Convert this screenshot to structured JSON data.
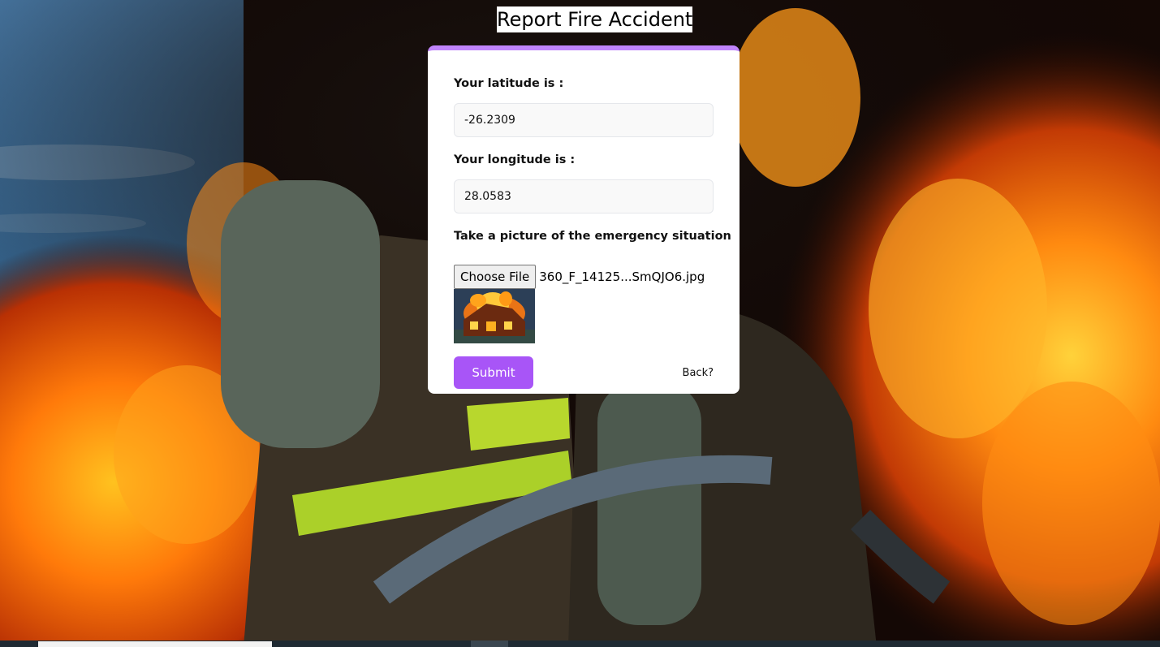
{
  "page": {
    "title": "Report Fire Accident"
  },
  "form": {
    "latitude_label": "Your latitude is :",
    "latitude_value": "-26.2309",
    "longitude_label": "Your longitude is :",
    "longitude_value": "28.0583",
    "picture_label": "Take a picture of the emergency situation",
    "choose_file_label": "Choose File",
    "file_name": "360_F_14125...SmQJO6.jpg",
    "submit_label": "Submit",
    "back_label": "Back?"
  },
  "colors": {
    "accent": "#a855f7",
    "card_top_border": "#c084fc",
    "card_background": "#ffffff"
  },
  "icons": {
    "preview": "burning-house-thumbnail"
  }
}
